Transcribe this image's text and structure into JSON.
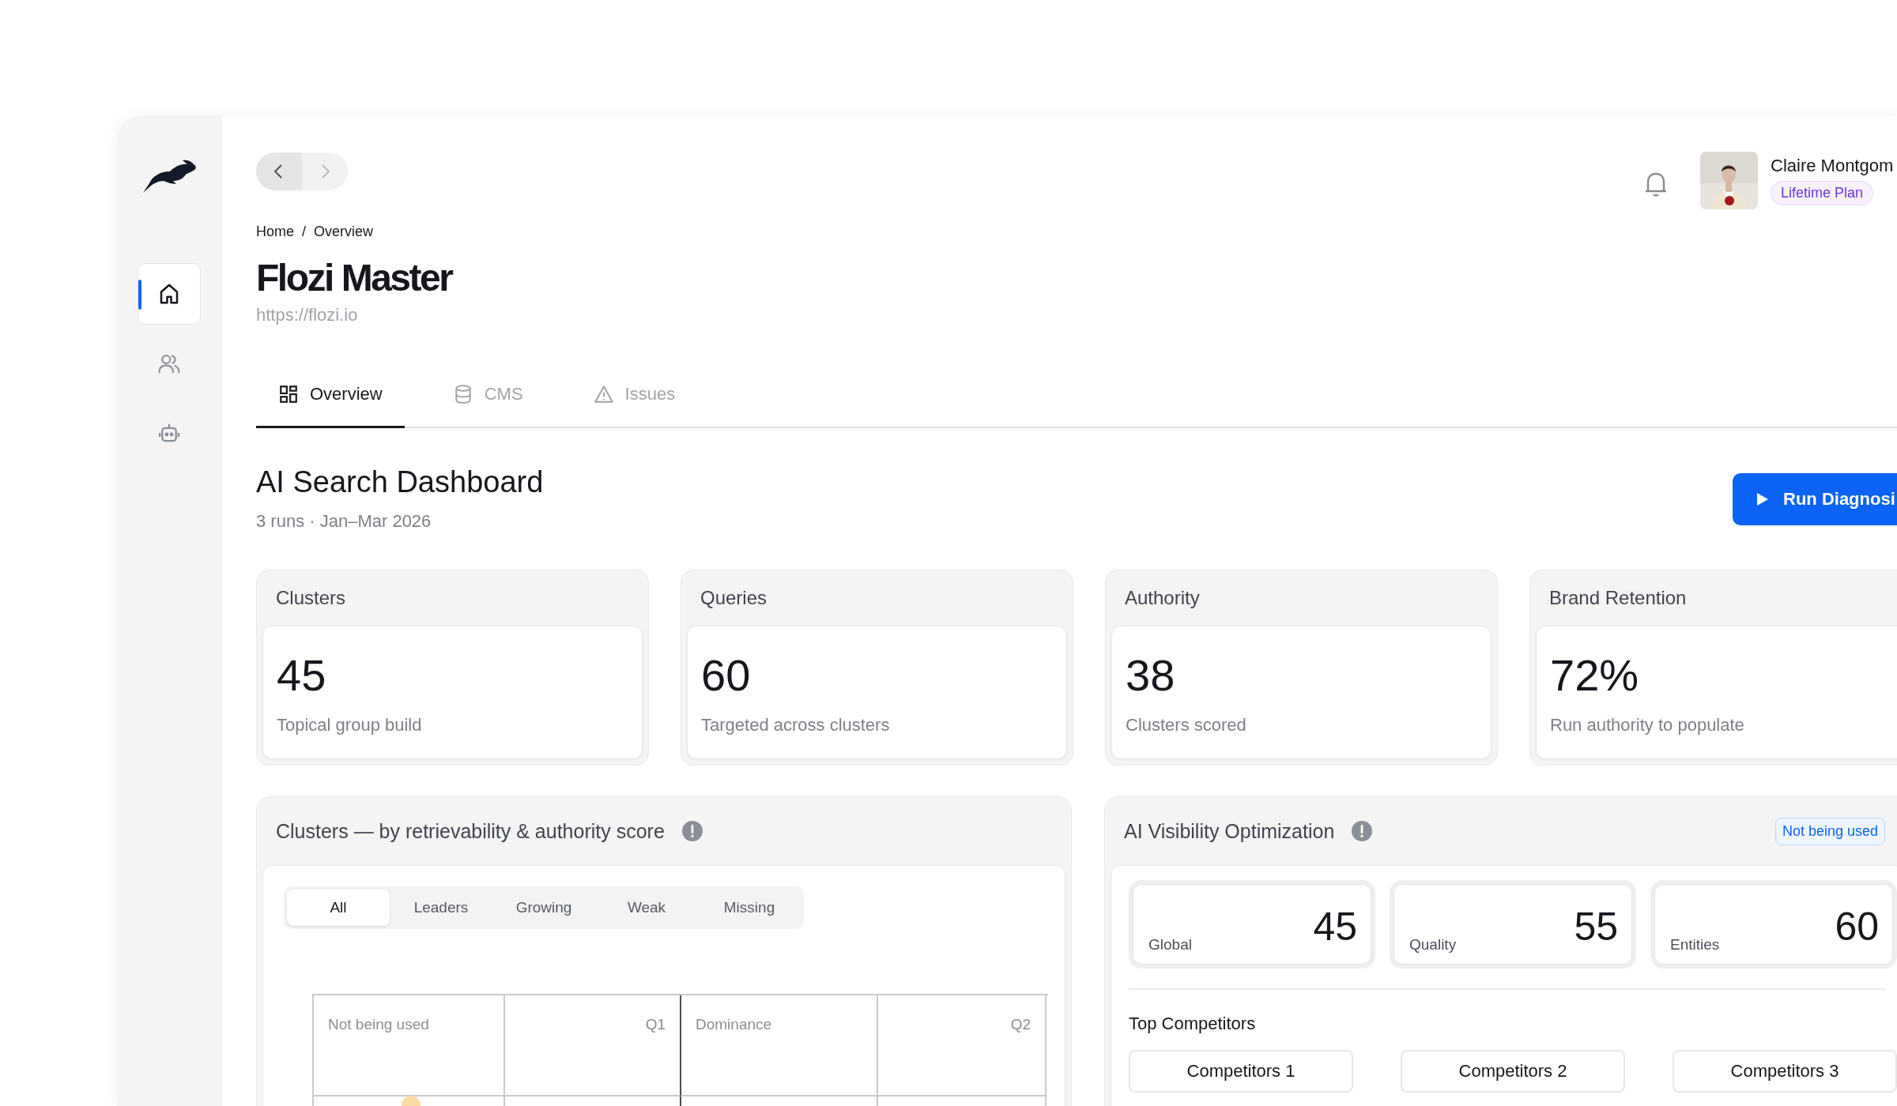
{
  "sidebar": {
    "items": [
      {
        "selected": true
      },
      {
        "selected": false
      },
      {
        "selected": false
      }
    ]
  },
  "nav": {
    "back_disabled": false,
    "forward_disabled": true
  },
  "breadcrumb": {
    "items": [
      "Home",
      "Overview"
    ],
    "separator": "/"
  },
  "site": {
    "title": "Flozi Master",
    "url": "https://flozi.io"
  },
  "user": {
    "name": "Claire Montgom",
    "plan": "Lifetime Plan"
  },
  "tabs": [
    {
      "label": "Overview",
      "selected": true
    },
    {
      "label": "CMS",
      "selected": false
    },
    {
      "label": "Issues",
      "selected": false
    }
  ],
  "dashboard": {
    "title": "AI Search Dashboard",
    "subtitle": "3 runs · Jan–Mar 2026",
    "action": "Run Diagnosi"
  },
  "stat_cards": [
    {
      "title": "Clusters",
      "value": "45",
      "caption": "Topical group build"
    },
    {
      "title": "Queries",
      "value": "60",
      "caption": "Targeted across clusters"
    },
    {
      "title": "Authority",
      "value": "38",
      "caption": "Clusters scored"
    },
    {
      "title": "Brand Retention",
      "value": "72%",
      "caption": "Run authority to populate"
    }
  ],
  "clusters_panel": {
    "title": "Clusters — by retrievability & authority score",
    "filters": [
      {
        "label": "All",
        "selected": true
      },
      {
        "label": "Leaders",
        "selected": false
      },
      {
        "label": "Growing",
        "selected": false
      },
      {
        "label": "Weak",
        "selected": false
      },
      {
        "label": "Missing",
        "selected": false
      }
    ],
    "quadrants": [
      {
        "label": "Not being used"
      },
      {
        "label": "Q1"
      },
      {
        "label": "Dominance"
      },
      {
        "label": "Q2"
      }
    ]
  },
  "visibility_panel": {
    "title": "AI Visibility Optimization",
    "badge": "Not being used",
    "metrics": [
      {
        "label": "Global",
        "value": "45"
      },
      {
        "label": "Quality",
        "value": "55"
      },
      {
        "label": "Entities",
        "value": "60"
      }
    ],
    "competitors_title": "Top Competitors",
    "competitors": [
      "Competitors 1",
      "Competitors 2",
      "Competitors 3"
    ]
  }
}
